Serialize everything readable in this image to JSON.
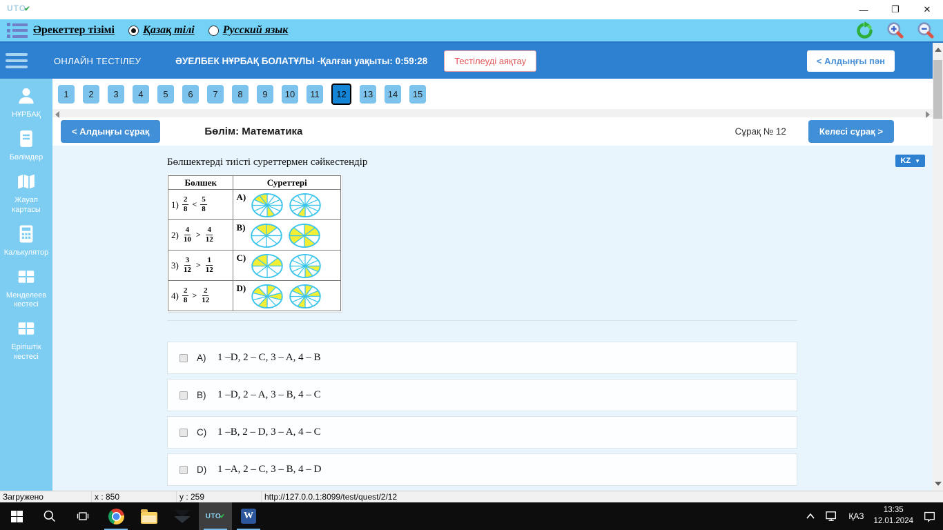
{
  "window": {
    "logo_text": "UTO",
    "logo_check": "✔",
    "controls": {
      "minimize": "—",
      "maximize": "❐",
      "close": "✕"
    }
  },
  "menubar": {
    "actions_label": "Әрекеттер тізімі",
    "lang_kk": "Қазақ тілі",
    "lang_ru": "Русский язык"
  },
  "header": {
    "app_title": "ОНЛАЙН ТЕСТІЛЕУ",
    "user_info": "ӘУЕЛБЕК НҰРБАҚ БОЛАТҰЛЫ -Қалған уақыты: 0:59:28",
    "finish_button": "Тестілеуді аяқтау",
    "prev_subject_button": "< Алдыңғы пән"
  },
  "sidebar": {
    "items": [
      {
        "label": "НҰРБАҚ",
        "icon": "user-icon"
      },
      {
        "label": "Бөлімдер",
        "icon": "book-icon"
      },
      {
        "label": "Жауап картасы",
        "icon": "map-icon"
      },
      {
        "label": "Калькулятор",
        "icon": "calculator-icon"
      },
      {
        "label": "Менделеев кестесі",
        "icon": "table-icon"
      },
      {
        "label": "Ерігіштік кестесі",
        "icon": "table-icon"
      }
    ]
  },
  "question_nav": {
    "numbers": [
      "1",
      "2",
      "3",
      "4",
      "5",
      "6",
      "7",
      "8",
      "9",
      "10",
      "11",
      "12",
      "13",
      "14",
      "15"
    ],
    "active": "12"
  },
  "toolbar": {
    "prev_question": "< Алдыңғы сұрақ",
    "section_label": "Бөлім: Математика",
    "question_label": "Сұрақ № 12",
    "next_question": "Келесі сұрақ >",
    "lang_dropdown": "KZ",
    "lang_caret": "▼"
  },
  "question": {
    "text": "Бөлшектерді тиісті суреттермен сәйкестендір",
    "table": {
      "headers": [
        "Болшек",
        "Суреттері"
      ],
      "rows": [
        {
          "no": "1)",
          "f1": {
            "n": "2",
            "d": "8"
          },
          "op": "<",
          "f2": {
            "n": "5",
            "d": "8"
          },
          "letter": "A)",
          "pies": [
            {
              "slices": 12,
              "yellow": [
                10,
                11,
                5
              ]
            },
            {
              "slices": 12,
              "yellow": [
                6
              ]
            }
          ]
        },
        {
          "no": "2)",
          "f1": {
            "n": "4",
            "d": "10"
          },
          "op": ">",
          "f2": {
            "n": "4",
            "d": "12"
          },
          "letter": "B)",
          "pies": [
            {
              "slices": 8,
              "yellow": [
                7,
                0
              ]
            },
            {
              "slices": 8,
              "yellow": [
                0,
                1,
                3,
                5,
                6
              ]
            }
          ]
        },
        {
          "no": "3)",
          "f1": {
            "n": "3",
            "d": "12"
          },
          "op": ">",
          "f2": {
            "n": "1",
            "d": "12"
          },
          "letter": "C)",
          "pies": [
            {
              "slices": 8,
              "yellow": [
                6,
                7,
                1
              ]
            },
            {
              "slices": 12,
              "yellow": [
                3,
                5
              ]
            }
          ]
        },
        {
          "no": "4)",
          "f1": {
            "n": "2",
            "d": "8"
          },
          "op": ">",
          "f2": {
            "n": "2",
            "d": "12"
          },
          "letter": "D)",
          "pies": [
            {
              "slices": 10,
              "yellow": [
                8,
                0,
                2,
                5
              ]
            },
            {
              "slices": 12,
              "yellow": [
                10,
                0,
                2,
                6
              ]
            }
          ]
        }
      ]
    }
  },
  "answers": [
    {
      "letter": "A)",
      "text": "1 –D, 2 – C, 3 – A, 4 – B"
    },
    {
      "letter": "B)",
      "text": "1 –D, 2 – A, 3 – B, 4 – C"
    },
    {
      "letter": "C)",
      "text": "1 –B, 2 – D, 3 – A, 4 – C"
    },
    {
      "letter": "D)",
      "text": "1 –A, 2 – C, 3 – B, 4 – D"
    }
  ],
  "statusbar": {
    "state": "Загружено",
    "x": "x : 850",
    "y": "y : 259",
    "url": "http://127.0.0.1:8099/test/quest/2/12"
  },
  "taskbar": {
    "language": "ҚАЗ",
    "time": "13:35",
    "date": "12.01.2024",
    "word_letter": "W",
    "uto_label": "UTO",
    "uto_check": "✔"
  },
  "colors": {
    "header_blue": "#2e80d1",
    "menubar_blue": "#74d2f7",
    "sidebar_blue": "#7dcdf3",
    "active_number_blue": "#1484d6",
    "button_blue": "#418fd7",
    "finish_red": "#e15457",
    "content_bg": "#e9f5fc",
    "pie_stroke": "#3bc5ec",
    "pie_yellow": "#f4ee35"
  }
}
